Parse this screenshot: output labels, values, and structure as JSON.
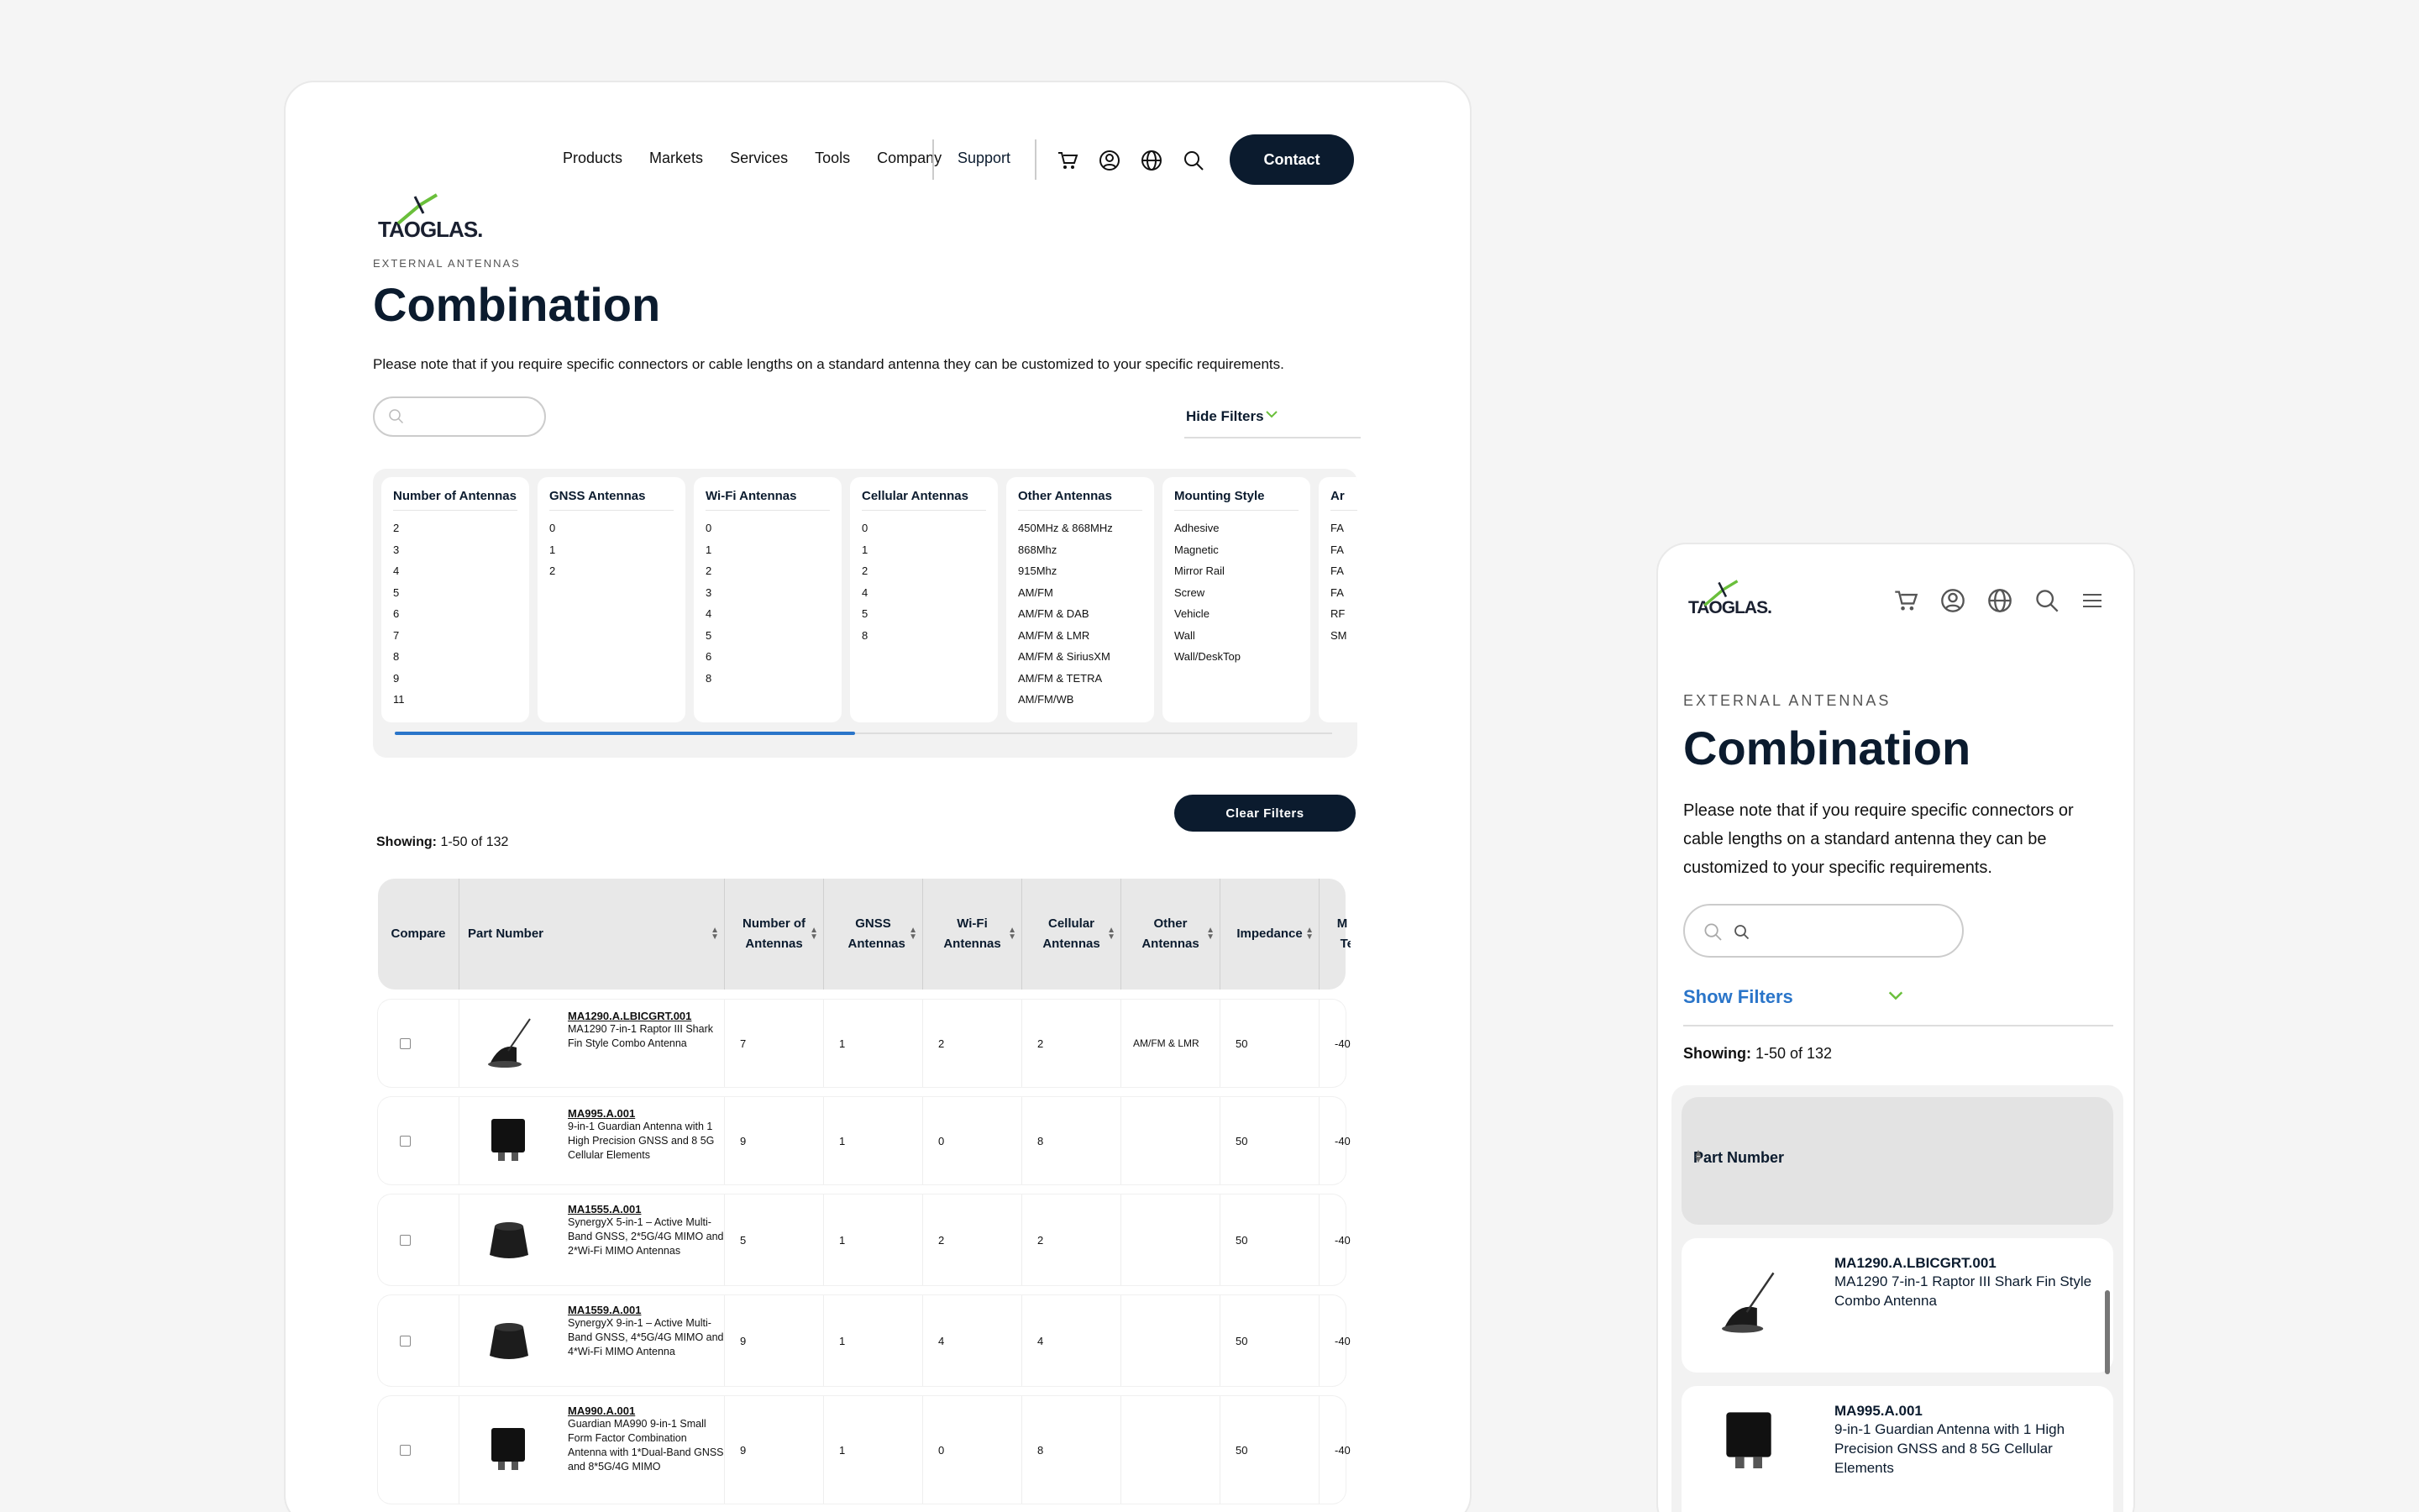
{
  "brand": {
    "name": "TAOGLAS."
  },
  "nav": {
    "links": [
      "Products",
      "Markets",
      "Services",
      "Tools",
      "Company"
    ],
    "support": "Support",
    "contact": "Contact"
  },
  "page": {
    "eyebrow": "EXTERNAL ANTENNAS",
    "title": "Combination",
    "note": "Please note that if you require specific connectors or cable lengths on a standard antenna they can be customized to your specific requirements.",
    "hide_filters": "Hide Filters",
    "show_filters": "Show Filters",
    "clear_filters": "Clear Filters",
    "showing_label": "Showing:",
    "showing_value": "1-50 of 132"
  },
  "filters": [
    {
      "title": "Number of Antennas",
      "options": [
        "2",
        "3",
        "4",
        "5",
        "6",
        "7",
        "8",
        "9",
        "11"
      ]
    },
    {
      "title": "GNSS Antennas",
      "options": [
        "0",
        "1",
        "2"
      ]
    },
    {
      "title": "Wi-Fi Antennas",
      "options": [
        "0",
        "1",
        "2",
        "3",
        "4",
        "5",
        "6",
        "8"
      ]
    },
    {
      "title": "Cellular Antennas",
      "options": [
        "0",
        "1",
        "2",
        "4",
        "5",
        "8"
      ]
    },
    {
      "title": "Other Antennas",
      "options": [
        "450MHz & 868MHz",
        "868Mhz",
        "915Mhz",
        "AM/FM",
        "AM/FM & DAB",
        "AM/FM & LMR",
        "AM/FM & SiriusXM",
        "AM/FM & TETRA",
        "AM/FM/WB"
      ]
    },
    {
      "title": "Mounting Style",
      "options": [
        "Adhesive",
        "Magnetic",
        "Mirror Rail",
        "Screw",
        "Vehicle",
        "Wall",
        "Wall/DeskTop"
      ]
    },
    {
      "title": "Ar",
      "options": [
        "FA",
        "FA",
        "FA",
        "FA",
        "RF",
        "SM"
      ]
    }
  ],
  "table": {
    "headers": [
      "Compare",
      "Part Number",
      "Number of Antennas",
      "GNSS Antennas",
      "Wi-Fi Antennas",
      "Cellular Antennas",
      "Other Antennas",
      "Impedance",
      "M Op Tem"
    ],
    "rows": [
      {
        "part": "MA1290.A.LBICGRT.001",
        "desc": "MA1290 7-in-1 Raptor III Shark Fin Style Combo Antenna",
        "antennas": "7",
        "gnss": "1",
        "wifi": "2",
        "cellular": "2",
        "other": "AM/FM & LMR",
        "impedance": "50",
        "temp": "-40",
        "shape": "shark-fin"
      },
      {
        "part": "MA995.A.001",
        "desc": "9-in-1 Guardian Antenna with 1 High Precision GNSS and 8 5G Cellular Elements",
        "antennas": "9",
        "gnss": "1",
        "wifi": "0",
        "cellular": "8",
        "other": "",
        "impedance": "50",
        "temp": "-40",
        "shape": "square"
      },
      {
        "part": "MA1555.A.001",
        "desc": "SynergyX 5-in-1 – Active Multi-Band GNSS, 2*5G/4G MIMO and 2*Wi-Fi MIMO Antennas",
        "antennas": "5",
        "gnss": "1",
        "wifi": "2",
        "cellular": "2",
        "other": "",
        "impedance": "50",
        "temp": "-40",
        "shape": "puck"
      },
      {
        "part": "MA1559.A.001",
        "desc": "SynergyX 9-in-1 – Active Multi-Band GNSS, 4*5G/4G MIMO and 4*Wi-Fi MIMO Antenna",
        "antennas": "9",
        "gnss": "1",
        "wifi": "4",
        "cellular": "4",
        "other": "",
        "impedance": "50",
        "temp": "-40",
        "shape": "puck"
      },
      {
        "part": "MA990.A.001",
        "desc": "Guardian MA990 9-in-1 Small Form Factor Combination Antenna with 1*Dual-Band GNSS and 8*5G/4G MIMO",
        "antennas": "9",
        "gnss": "1",
        "wifi": "0",
        "cellular": "8",
        "other": "",
        "impedance": "50",
        "temp": "-40",
        "shape": "square"
      }
    ]
  },
  "mobile": {
    "header_part": "Part Number",
    "rows": [
      {
        "part": "MA1290.A.LBICGRT.001",
        "desc": "MA1290 7-in-1 Raptor III Shark Fin Style Combo Antenna"
      },
      {
        "part": "MA995.A.001",
        "desc": "9-in-1 Guardian Antenna with 1 High Precision GNSS and 8 5G Cellular Elements"
      }
    ]
  },
  "colors": {
    "navy": "#0b1b2e",
    "accent_blue": "#2a75c9",
    "logo_green": "#6abf3b"
  },
  "icons": [
    "cart-icon",
    "account-icon",
    "globe-icon",
    "search-icon",
    "menu-icon",
    "chevron-down-icon",
    "sort-icon"
  ]
}
